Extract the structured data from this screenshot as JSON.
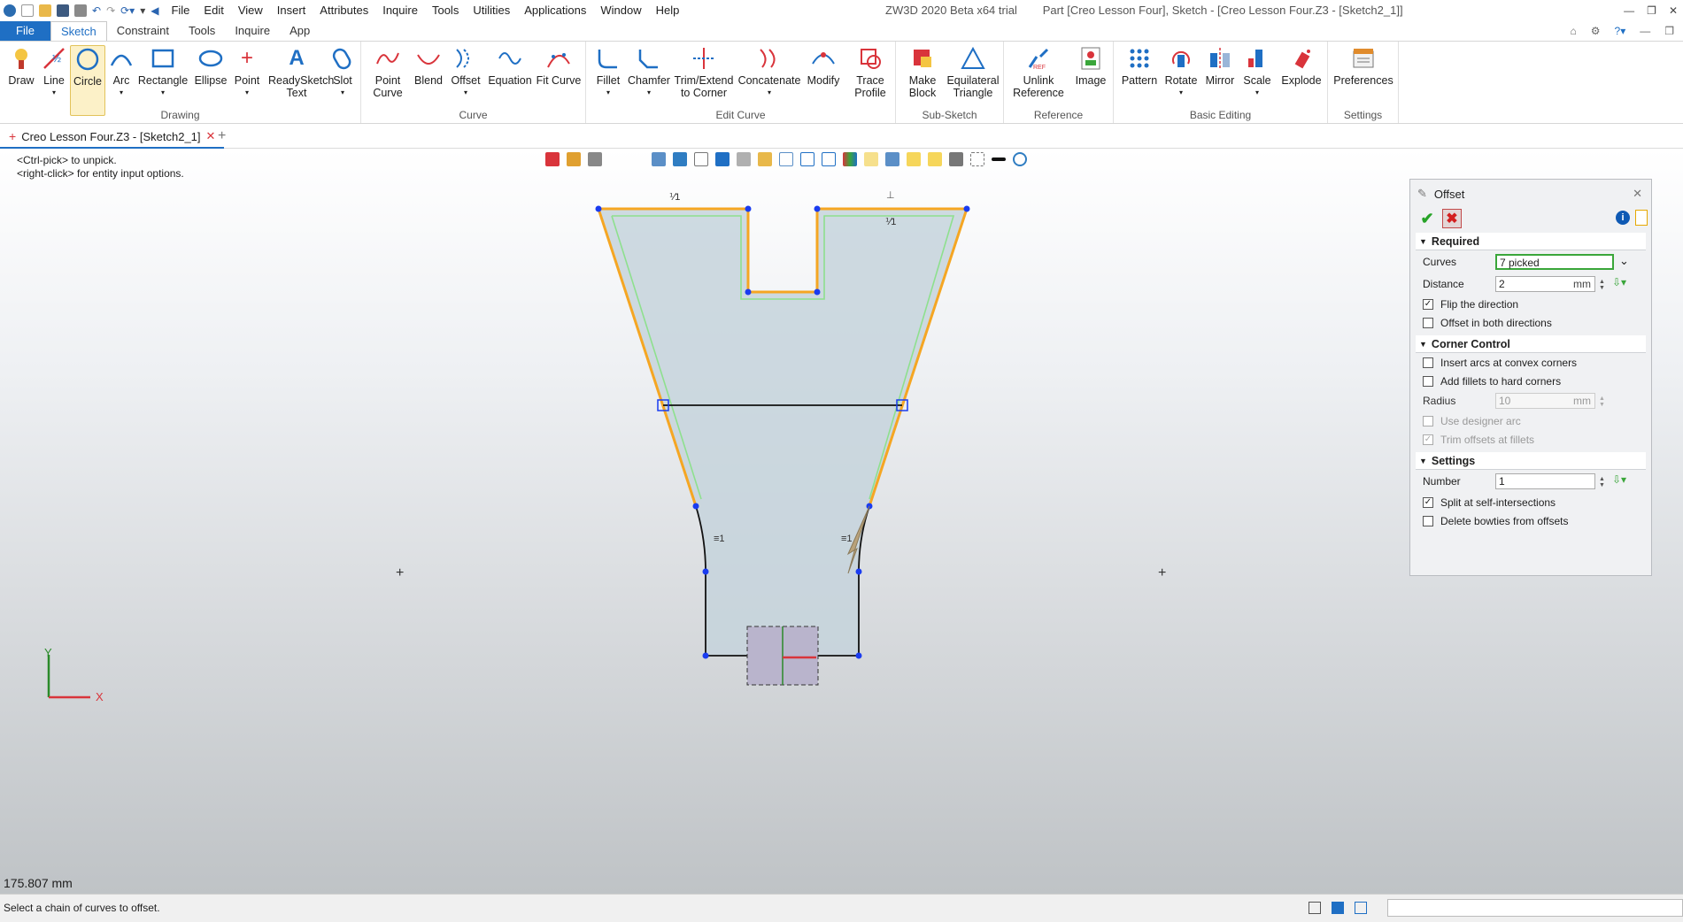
{
  "titlebar": {
    "menu": [
      "File",
      "Edit",
      "View",
      "Insert",
      "Attributes",
      "Inquire",
      "Tools",
      "Utilities",
      "Applications",
      "Window",
      "Help"
    ],
    "app_title": "ZW3D 2020 Beta x64 trial",
    "doc_title": "Part [Creo Lesson Four],  Sketch - [Creo Lesson Four.Z3 - [Sketch2_1]]"
  },
  "tabs": [
    "File",
    "Sketch",
    "Constraint",
    "Tools",
    "Inquire",
    "App"
  ],
  "ribbon": {
    "groups": {
      "drawing": "Drawing",
      "curve": "Curve",
      "edit_curve": "Edit Curve",
      "sub_sketch": "Sub-Sketch",
      "reference": "Reference",
      "basic_editing": "Basic Editing",
      "settings": "Settings"
    },
    "buttons": {
      "draw": "Draw",
      "line": "Line",
      "circle": "Circle",
      "arc": "Arc",
      "rectangle": "Rectangle",
      "ellipse": "Ellipse",
      "point": "Point",
      "readysketch": "ReadySketch Text",
      "slot": "Slot",
      "point_curve": "Point Curve",
      "blend": "Blend",
      "offset": "Offset",
      "equation": "Equation",
      "fit_curve": "Fit Curve",
      "fillet": "Fillet",
      "chamfer": "Chamfer",
      "trim_extend": "Trim/Extend to Corner",
      "concatenate": "Concatenate",
      "modify": "Modify",
      "trace_profile": "Trace Profile",
      "make_block": "Make Block",
      "equilateral": "Equilateral Triangle",
      "unlink": "Unlink Reference",
      "image": "Image",
      "pattern": "Pattern",
      "rotate": "Rotate",
      "mirror": "Mirror",
      "scale": "Scale",
      "explode": "Explode",
      "preferences": "Preferences"
    }
  },
  "doc_tab": "Creo Lesson Four.Z3 - [Sketch2_1]",
  "hints": [
    "<Ctrl-pick> to unpick.",
    "<right-click> for entity input options."
  ],
  "viewport": {
    "coord_readout": "175.807 mm",
    "axis_x": "X",
    "axis_y": "Y",
    "constraint_marks": [
      "⅟1",
      "⅟1",
      "≡1",
      "≡1",
      "⊥"
    ]
  },
  "offset_panel": {
    "title": "Offset",
    "sections": {
      "required": "Required",
      "corner_control": "Corner Control",
      "settings": "Settings"
    },
    "curves_label": "Curves",
    "curves_value": "7 picked",
    "distance_label": "Distance",
    "distance_value": "2",
    "distance_unit": "mm",
    "flip_direction": "Flip the direction",
    "offset_both": "Offset in both directions",
    "insert_arcs": "Insert arcs at convex corners",
    "add_fillets": "Add fillets to hard corners",
    "radius_label": "Radius",
    "radius_value": "10",
    "radius_unit": "mm",
    "designer_arc": "Use designer arc",
    "trim_offsets": "Trim offsets at fillets",
    "number_label": "Number",
    "number_value": "1",
    "split_self": "Split at self-intersections",
    "delete_bowties": "Delete bowties from offsets",
    "checkmark": "✓"
  },
  "status": {
    "message": "Select a chain of curves to offset."
  },
  "colors": {
    "accent": "#1f6fc4",
    "selected_curve": "#f5a623",
    "offset_preview": "#8ee08e",
    "sketch_fill": "#c6d3dc"
  }
}
